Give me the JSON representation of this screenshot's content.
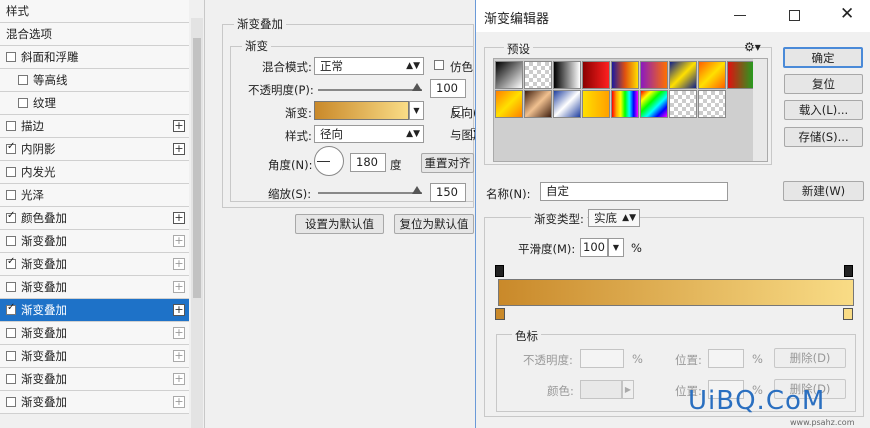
{
  "styles_panel": {
    "items": [
      {
        "label": "样式",
        "checkbox": false,
        "plus": false,
        "indent": 0
      },
      {
        "label": "混合选项",
        "checkbox": false,
        "plus": false,
        "indent": 0
      },
      {
        "label": "斜面和浮雕",
        "checkbox": true,
        "checked": false,
        "plus": false,
        "indent": 0
      },
      {
        "label": "等高线",
        "checkbox": true,
        "checked": false,
        "plus": false,
        "indent": 1
      },
      {
        "label": "纹理",
        "checkbox": true,
        "checked": false,
        "plus": false,
        "indent": 1
      },
      {
        "label": "描边",
        "checkbox": true,
        "checked": false,
        "plus": true,
        "indent": 0
      },
      {
        "label": "内阴影",
        "checkbox": true,
        "checked": true,
        "plus": true,
        "indent": 0
      },
      {
        "label": "内发光",
        "checkbox": true,
        "checked": false,
        "plus": false,
        "indent": 0
      },
      {
        "label": "光泽",
        "checkbox": true,
        "checked": false,
        "plus": false,
        "indent": 0
      },
      {
        "label": "颜色叠加",
        "checkbox": true,
        "checked": true,
        "plus": true,
        "indent": 0
      },
      {
        "label": "渐变叠加",
        "checkbox": true,
        "checked": false,
        "plus": true,
        "plus_dim": true,
        "indent": 0
      },
      {
        "label": "渐变叠加",
        "checkbox": true,
        "checked": true,
        "plus": true,
        "plus_dim": true,
        "indent": 0
      },
      {
        "label": "渐变叠加",
        "checkbox": true,
        "checked": false,
        "plus": true,
        "plus_dim": true,
        "indent": 0
      },
      {
        "label": "渐变叠加",
        "checkbox": true,
        "checked": true,
        "plus": true,
        "selected": true,
        "indent": 0
      },
      {
        "label": "渐变叠加",
        "checkbox": true,
        "checked": false,
        "plus": true,
        "plus_dim": true,
        "indent": 0
      },
      {
        "label": "渐变叠加",
        "checkbox": true,
        "checked": false,
        "plus": true,
        "plus_dim": true,
        "indent": 0
      },
      {
        "label": "渐变叠加",
        "checkbox": true,
        "checked": false,
        "plus": true,
        "plus_dim": true,
        "indent": 0
      },
      {
        "label": "渐变叠加",
        "checkbox": true,
        "checked": false,
        "plus": true,
        "plus_dim": true,
        "indent": 0
      }
    ]
  },
  "gradient_overlay": {
    "section_title": "渐变叠加",
    "group_title": "渐变",
    "blend_mode_label": "混合模式:",
    "blend_mode_value": "正常",
    "dither_label": "仿色",
    "opacity_label": "不透明度(P):",
    "opacity_value": "100",
    "gradient_label": "渐变:",
    "reverse_label": "反向(",
    "style_label": "样式:",
    "style_value": "径向",
    "align_label": "与图层",
    "angle_label": "角度(N):",
    "angle_value": "180",
    "angle_unit": "度",
    "reset_align_label": "重置对齐",
    "scale_label": "缩放(S):",
    "scale_value": "150",
    "set_default_label": "设置为默认值",
    "reset_default_label": "复位为默认值",
    "gradient_from": "#c9892a",
    "gradient_to": "#f9dc86"
  },
  "editor": {
    "title": "渐变编辑器",
    "presets_label": "预设",
    "ok_label": "确定",
    "reset_label": "复位",
    "load_label": "载入(L)...",
    "save_label": "存储(S)...",
    "name_label": "名称(N):",
    "name_value": "自定",
    "new_label": "新建(W)",
    "type_label": "渐变类型:",
    "type_value": "实底",
    "smooth_label": "平滑度(M):",
    "smooth_value": "100",
    "smooth_unit": "%",
    "stops_label": "色标",
    "stop_opacity_label": "不透明度:",
    "stop_color_label": "颜色:",
    "location_label": "位置:",
    "location_unit": "%",
    "delete_label": "删除(D)",
    "delete2_label": "删除(D)",
    "gradient_from": "#c9892a",
    "gradient_to": "#f9dc86"
  },
  "watermark": {
    "text": "UiBQ.CoM",
    "site": "www.psahz.com"
  }
}
